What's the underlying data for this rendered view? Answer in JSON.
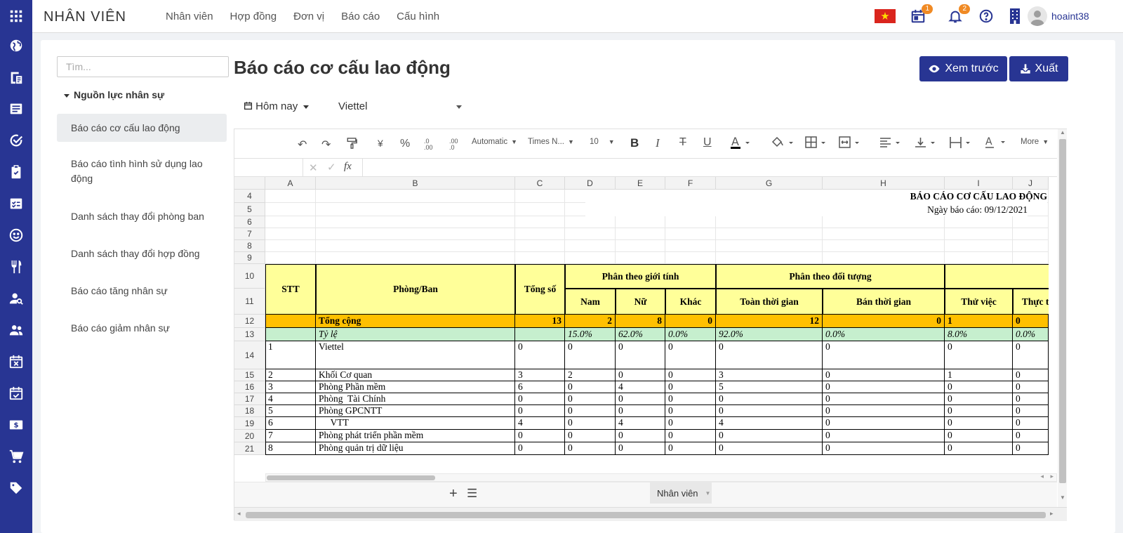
{
  "topbar": {
    "app_name": "NHÂN VIÊN",
    "nav": [
      "Nhân viên",
      "Hợp đồng",
      "Đơn vị",
      "Báo cáo",
      "Cấu hình"
    ],
    "calendar_badge": "1",
    "bell_badge": "2",
    "username": "hoaint38"
  },
  "sidebar": {
    "search_placeholder": "Tìm...",
    "group": "Nguồn lực nhân sự",
    "items": [
      "Báo cáo cơ cấu lao động",
      "Báo cáo tình hình sử dụng lao động",
      "Danh sách thay đổi phòng ban",
      "Danh sách thay đổi hợp đồng",
      "Báo cáo tăng nhân sự",
      "Báo cáo giảm nhân sự"
    ]
  },
  "page": {
    "title": "Báo cáo cơ cấu lao động",
    "preview_label": "Xem trước",
    "export_label": "Xuất",
    "date_filter": "Hôm nay",
    "company_filter": "Viettel"
  },
  "toolbar": {
    "currency": "¥",
    "percent": "%",
    "dec_inc": ".0 .00",
    "dec_dec": ".00 .0",
    "format": "Automatic",
    "font": "Times N...",
    "size": "10",
    "bold": "B",
    "italic": "I",
    "strike": "T",
    "underline": "U",
    "more": "More",
    "fx": "fx"
  },
  "sheet": {
    "columns": [
      "A",
      "B",
      "C",
      "D",
      "E",
      "F",
      "G",
      "H",
      "I",
      "J"
    ],
    "row_numbers": [
      "4",
      "5",
      "6",
      "7",
      "8",
      "9",
      "10",
      "11",
      "12",
      "13",
      "14",
      "15",
      "16",
      "17",
      "18",
      "19",
      "20",
      "21"
    ],
    "report_title": "BÁO CÁO CƠ CẤU LAO ĐỘNG",
    "report_date": "Ngày báo cáo: 09/12/2021",
    "headers": {
      "stt": "STT",
      "dept": "Phòng/Ban",
      "total": "Tổng số",
      "gender_group": "Phân theo giới tính",
      "male": "Nam",
      "female": "Nữ",
      "other": "Khác",
      "type_group": "Phân theo đối tượng",
      "fulltime": "Toàn thời gian",
      "parttime": "Bán thời gian",
      "probation": "Thử việc",
      "intern": "Thực tậ"
    },
    "total_row": {
      "label": "Tổng cộng",
      "values": [
        "13",
        "2",
        "8",
        "0",
        "12",
        "0",
        "1",
        "0"
      ]
    },
    "ratio_row": {
      "label": "Tỷ lệ",
      "values": [
        "",
        "15.0%",
        "62.0%",
        "0.0%",
        "92.0%",
        "0.0%",
        "8.0%",
        "0.0%"
      ]
    },
    "rows": [
      {
        "stt": "1",
        "name": "Viettel",
        "v": [
          "0",
          "0",
          "0",
          "0",
          "0",
          "0",
          "0",
          "0"
        ]
      },
      {
        "stt": "2",
        "name": "Khối Cơ quan",
        "v": [
          "3",
          "2",
          "0",
          "0",
          "3",
          "0",
          "1",
          "0"
        ]
      },
      {
        "stt": "3",
        "name": "Phòng Phần mềm",
        "v": [
          "6",
          "0",
          "4",
          "0",
          "5",
          "0",
          "0",
          "0"
        ]
      },
      {
        "stt": "4",
        "name": "Phòng  Tài Chính",
        "v": [
          "0",
          "0",
          "0",
          "0",
          "0",
          "0",
          "0",
          "0"
        ]
      },
      {
        "stt": "5",
        "name": "Phòng GPCNTT",
        "v": [
          "0",
          "0",
          "0",
          "0",
          "0",
          "0",
          "0",
          "0"
        ]
      },
      {
        "stt": "6",
        "name": "     VTT",
        "v": [
          "4",
          "0",
          "4",
          "0",
          "4",
          "0",
          "0",
          "0"
        ]
      },
      {
        "stt": "7",
        "name": "Phòng phát triển phần mềm",
        "v": [
          "0",
          "0",
          "0",
          "0",
          "0",
          "0",
          "0",
          "0"
        ]
      },
      {
        "stt": "8",
        "name": "Phòng quản trị dữ liệu",
        "v": [
          "0",
          "0",
          "0",
          "0",
          "0",
          "0",
          "0",
          "0"
        ]
      }
    ],
    "sheet_tab": "Nhân viên"
  },
  "colors": {
    "rail": "#283593",
    "primary": "#283593",
    "header_fill": "#ffff99",
    "total_fill": "#ffc000",
    "ratio_fill": "#c6efce"
  }
}
